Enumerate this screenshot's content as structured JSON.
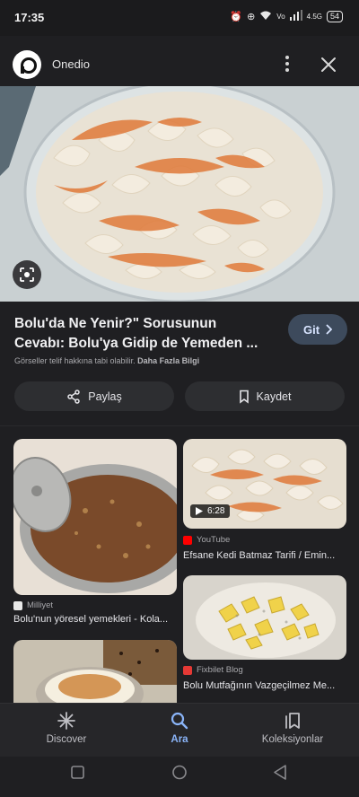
{
  "status_bar": {
    "time": "17:35",
    "network": "4.5G",
    "battery": "54"
  },
  "header": {
    "source_name": "Onedio"
  },
  "result": {
    "title": "Bolu'da Ne Yenir?\" Sorusunun Cevabı: Bolu'ya Gidip de Yemeden ...",
    "visit_label": "Git",
    "copyright_text": "Görseller telif hakkına tabi olabilir.",
    "learn_more": "Daha Fazla Bilgi",
    "share_label": "Paylaş",
    "save_label": "Kaydet"
  },
  "related": [
    {
      "source": "Milliyet",
      "title": "Bolu'nun yöresel yemekleri - Kola...",
      "favicon_color": "#e8e8e8"
    },
    {
      "source": "YouTube",
      "title": "Efsane Kedi Batmaz Tarifi / Emin...",
      "duration": "6:28",
      "favicon_color": "#ff0000"
    },
    {
      "source": "Fixbilet Blog",
      "title": "Bolu Mutfağının Vazgeçilmez Me...",
      "favicon_color": "#e53935"
    }
  ],
  "bottom_nav": {
    "items": [
      {
        "label": "Discover",
        "icon": "asterisk-icon"
      },
      {
        "label": "Ara",
        "icon": "search-icon"
      },
      {
        "label": "Koleksiyonlar",
        "icon": "collections-icon"
      }
    ],
    "active_color": "#8ab4f8"
  }
}
